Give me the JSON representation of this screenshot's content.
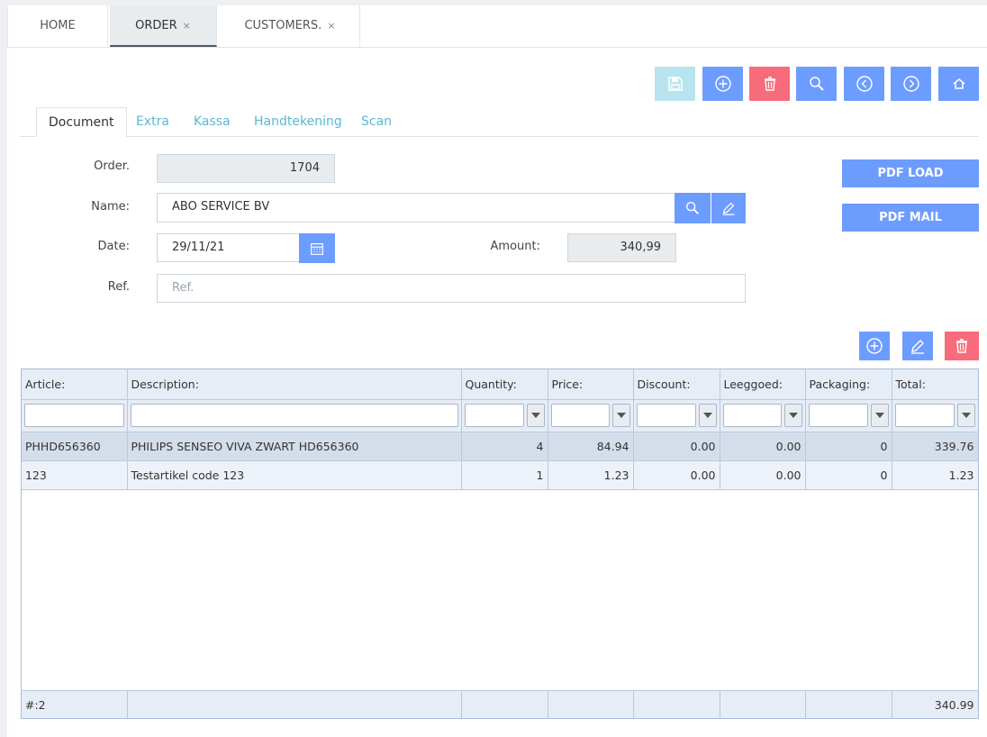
{
  "app_tabs": [
    {
      "label": "HOME"
    },
    {
      "label": "ORDER",
      "close": "×"
    },
    {
      "label": "CUSTOMERS.",
      "close": "×"
    }
  ],
  "doc_tabs": [
    "Document",
    "Extra",
    "Kassa",
    "Handtekening",
    "Scan"
  ],
  "form": {
    "order_label": "Order.",
    "order_value": "1704",
    "name_label": "Name:",
    "name_value": "ABO SERVICE BV",
    "date_label": "Date:",
    "date_value": "29/11/21",
    "amount_label": "Amount:",
    "amount_value": "340,99",
    "ref_label": "Ref.",
    "ref_placeholder": "Ref."
  },
  "buttons": {
    "pdf_load": "PDF LOAD",
    "pdf_mail": "PDF MAIL"
  },
  "icons": {
    "save": "save-icon",
    "add": "plus-circle-icon",
    "delete": "trash-icon",
    "search": "search-icon",
    "prev": "chevron-left-circle-icon",
    "next": "chevron-right-circle-icon",
    "home": "home-icon",
    "edit": "pencil-icon",
    "calendar": "calendar-icon"
  },
  "colors": {
    "primary": "#6d9cff",
    "danger": "#f86b7a",
    "disabled": "#b8e4ef",
    "tab_link": "#5bb7d3"
  },
  "grid": {
    "columns": [
      "Article:",
      "Description:",
      "Quantity:",
      "Price:",
      "Discount:",
      "Leeggoed:",
      "Packaging:",
      "Total:"
    ],
    "rows": [
      {
        "article": "PHHD656360",
        "description": "PHILIPS SENSEO VIVA ZWART HD656360",
        "quantity": "4",
        "price": "84.94",
        "discount": "0.00",
        "leeggoed": "0.00",
        "packaging": "0",
        "total": "339.76"
      },
      {
        "article": "123",
        "description": "Testartikel code 123",
        "quantity": "1",
        "price": "1.23",
        "discount": "0.00",
        "leeggoed": "0.00",
        "packaging": "0",
        "total": "1.23"
      }
    ],
    "footer_count": "#:2",
    "footer_total": "340.99"
  }
}
